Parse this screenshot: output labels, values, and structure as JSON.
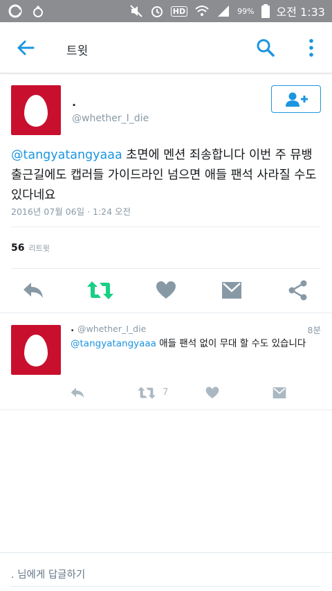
{
  "status_bar": {
    "battery": "99%",
    "time": "오전 1:33",
    "hd_label": "HD"
  },
  "app_bar": {
    "title": "트윗"
  },
  "tweet": {
    "display_name": ".",
    "handle": "@whether_I_die",
    "mention": "@tangyatangyaaa",
    "body": " 초면에 멘션 죄송합니다 이번 주 뮤뱅 출근길에도 캡러들 가이드라인 넘으면 애들 팬석 사라질 수도 있다네요",
    "timestamp": "2016년 07월 06일 · 1:24 오전",
    "retweet_count": "56",
    "retweet_label": "리트윗"
  },
  "reply": {
    "display_name": ".",
    "handle": "@whether_I_die",
    "age": "8분",
    "mention": "@tangyatangyaaa",
    "body": " 애들 팬석 없이 무대 할 수도 있습니다",
    "retweet_count": "7"
  },
  "compose": {
    "placeholder": ". 님에게 답글하기"
  },
  "colors": {
    "accent": "#1b95e0",
    "retweet_green": "#19cf86",
    "avatar_red": "#c8102e",
    "action_gray": "#8899a6",
    "status_bar": "#8b8d90"
  }
}
